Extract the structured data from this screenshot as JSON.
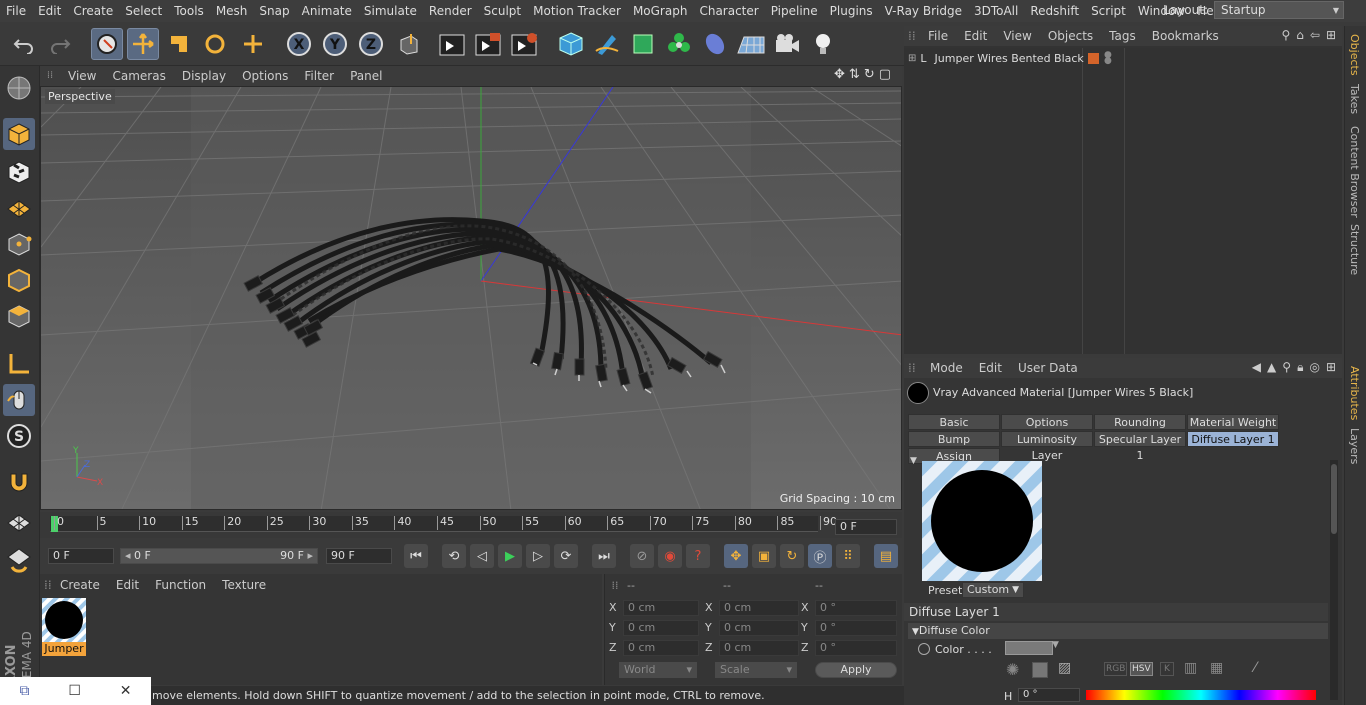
{
  "menu": [
    "File",
    "Edit",
    "Create",
    "Select",
    "Tools",
    "Mesh",
    "Snap",
    "Animate",
    "Simulate",
    "Render",
    "Sculpt",
    "Motion Tracker",
    "MoGraph",
    "Character",
    "Pipeline",
    "Plugins",
    "V-Ray Bridge",
    "3DToAll",
    "Redshift",
    "Script",
    "Window",
    "Help"
  ],
  "layout": {
    "label": "Layout:",
    "value": "Startup"
  },
  "toolbar_icons": [
    "undo-icon",
    "redo-icon",
    "live-select-icon",
    "move-icon",
    "scale-icon",
    "rotate-icon",
    "recent-tool-icon",
    "x-axis-icon",
    "y-axis-icon",
    "z-axis-icon",
    "world-coord-icon",
    "render-view-icon",
    "render-active-icon",
    "render-settings-icon",
    "cube-icon",
    "pen-icon",
    "subdivision-icon",
    "cloner-icon",
    "deformer-icon",
    "floor-icon",
    "camera-icon",
    "light-icon"
  ],
  "axis_letters": [
    "X",
    "Y",
    "Z"
  ],
  "viewport": {
    "menu": [
      "View",
      "Cameras",
      "Display",
      "Options",
      "Filter",
      "Panel"
    ],
    "name": "Perspective",
    "grid_spacing": "Grid Spacing : 10 cm"
  },
  "timeline": {
    "ticks": [
      "0",
      "5",
      "10",
      "15",
      "20",
      "25",
      "30",
      "35",
      "40",
      "45",
      "50",
      "55",
      "60",
      "65",
      "70",
      "75",
      "80",
      "85",
      "90"
    ],
    "current_frame": "0 F",
    "start": "0 F",
    "range_start": "0 F",
    "range_end": "90 F",
    "end": "90 F"
  },
  "material_manager": {
    "menu": [
      "Create",
      "Edit",
      "Function",
      "Texture"
    ],
    "material_name": "Jumper"
  },
  "coords": {
    "headers": [
      "--",
      "--",
      "--"
    ],
    "rows": [
      {
        "axis": "X",
        "pos": "0 cm",
        "axis2": "X",
        "size": "0 cm",
        "axis3": "X",
        "rot": "0 °"
      },
      {
        "axis": "Y",
        "pos": "0 cm",
        "axis2": "Y",
        "size": "0 cm",
        "axis3": "Y",
        "rot": "0 °"
      },
      {
        "axis": "Z",
        "pos": "0 cm",
        "axis2": "Z",
        "size": "0 cm",
        "axis3": "Z",
        "rot": "0 °"
      }
    ],
    "space": "World",
    "mode": "Scale",
    "apply": "Apply"
  },
  "status": "move elements. Hold down SHIFT to quantize movement / add to the selection in point mode, CTRL to remove.",
  "object_manager": {
    "menu": [
      "File",
      "Edit",
      "View",
      "Objects",
      "Tags",
      "Bookmarks"
    ],
    "object_name": "Jumper Wires Bented Black"
  },
  "attributes": {
    "menu": [
      "Mode",
      "Edit",
      "User Data"
    ],
    "title": "Vray Advanced Material [Jumper Wires 5 Black]",
    "tabs_row1": [
      "Basic",
      "Options",
      "Rounding",
      "Material Weight"
    ],
    "tabs_row2": [
      "Bump",
      "Luminosity Layer",
      "Specular Layer 1",
      "Diffuse Layer 1"
    ],
    "tabs_row3": [
      "Assign"
    ],
    "preset_label": "Preset",
    "preset_value": "Custom",
    "section": "Diffuse Layer 1",
    "subsection": "Diffuse Color",
    "color_label": "Color . . . .",
    "color_modes": [
      "RGB",
      "HSV",
      "K"
    ],
    "h_label": "H",
    "h_value": "0 °"
  },
  "side_tabs": [
    "Objects",
    "Takes",
    "Content Browser",
    "Structure"
  ],
  "side_tabs_bottom": [
    "Attributes",
    "Layers"
  ],
  "logo_text": "MAXON CINEMA 4D"
}
